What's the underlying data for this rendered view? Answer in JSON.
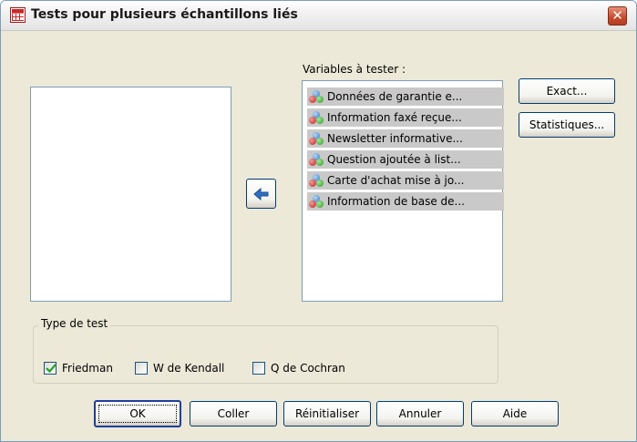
{
  "window": {
    "title": "Tests pour plusieurs échantillons liés",
    "close_glyph": "✕"
  },
  "variables_label": "Variables à tester :",
  "variables": [
    "Données de garantie e...",
    "Information faxé reçue...",
    "Newsletter informative...",
    "Question ajoutée à list...",
    "Carte d'achat mise à jo...",
    "Information de base de..."
  ],
  "side_buttons": {
    "exact": "Exact...",
    "statistics": "Statistiques..."
  },
  "test_type": {
    "group_label": "Type de test",
    "options": [
      {
        "label": "Friedman",
        "checked": true
      },
      {
        "label": "W de Kendall",
        "checked": false
      },
      {
        "label": "Q de Cochran",
        "checked": false
      }
    ]
  },
  "buttons": {
    "ok": "OK",
    "paste": "Coller",
    "reset": "Réinitialiser",
    "cancel": "Annuler",
    "help": "Aide"
  },
  "icons": {
    "app": "spss-grid-icon",
    "variable": "nominal-variable-icon",
    "move": "arrow-left-icon"
  },
  "colors": {
    "dialog_bg": "#ece9d8",
    "selected_item": "#c9c9c9",
    "button_border": "#003c74",
    "close_red": "#c54a2c"
  }
}
